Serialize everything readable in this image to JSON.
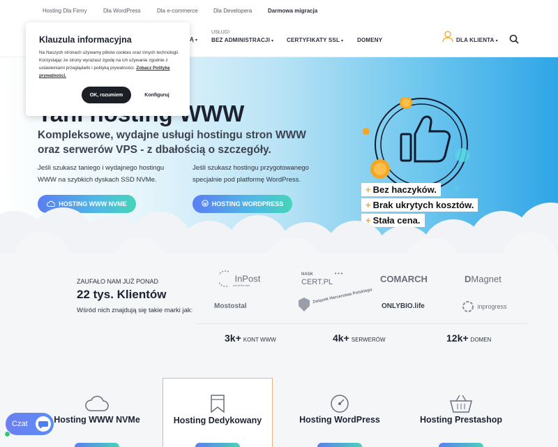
{
  "topbar": {
    "links": [
      "Hosting Dla Firmy",
      "Dla WordPress",
      "Dla e-commerce",
      "Dla Developera",
      "Darmowa migracja"
    ]
  },
  "nav": {
    "partial": "Ą",
    "uslugi_label": "USŁUGI",
    "bez_admin": "BEZ ADMINISTRACJI",
    "ssl": "CERTYFIKATY SSL",
    "domeny": "DOMENY",
    "client": "DLA KLIENTA"
  },
  "hero": {
    "title": "Tani hosting WWW",
    "subtitle": "Kompleksowe, wydajne usługi hostingu stron WWW oraz serwerów VPS - z dbałością o szczegóły.",
    "col1": "Jeśli szukasz taniego i wydajnego hostingu WWW na szybkich dyskach SSD NVMe.",
    "col2": "Jeśli szukasz hostingu przygotowanego specjalnie pod platformę WordPress.",
    "btn1": "HOSTING WWW NVME",
    "btn2": "HOSTING WORDPRESS",
    "pills": [
      "Bez haczyków.",
      "Brak ukrytych kosztów.",
      "Stała cena."
    ]
  },
  "cookie": {
    "title": "Klauzula informacyjna",
    "text": "Na Naszych stronach używamy plików cookies oraz innych technologii. Korzystając ze strony wyrażasz zgodę na ich używanie zgodnie z ustawieniami przeglądarki i polityką prywatności.",
    "link": "Zobacz Politykę prywatności.",
    "ok": "OK, rozumiem",
    "configure": "Konfiguruj"
  },
  "trust": {
    "line1": "ZAUFAŁO NAM JUŻ PONAD",
    "line2": "22 tys. Klientów",
    "line3": "Wśród nich znajdują się takie marki jak:",
    "logos": [
      "InPost",
      "CERT.PL",
      "COMARCH",
      "Magnet",
      "Mostostal",
      "Związek Harcerstwa Polskiego",
      "ONLYBIO.life",
      "inprogress"
    ],
    "logo_sub": {
      "inpost": "out of the box",
      "nask": "NASK"
    }
  },
  "stats": [
    {
      "num": "3k+",
      "label": "KONT WWW"
    },
    {
      "num": "4k+",
      "label": "SERWERÓW"
    },
    {
      "num": "12k+",
      "label": "DOMEN"
    }
  ],
  "cards": [
    {
      "title": "Hosting WWW NVMe",
      "icon": "cloud-icon"
    },
    {
      "title": "Hosting Dedykowany",
      "icon": "bookmark-icon"
    },
    {
      "title": "Hosting WordPress",
      "icon": "gauge-icon"
    },
    {
      "title": "Hosting Prestashop",
      "icon": "basket-icon"
    }
  ],
  "chat": {
    "label": "Czat"
  },
  "colors": {
    "accent_orange": "#f5a623",
    "gradient_start": "#5b7ef2",
    "gradient_end": "#46d4b8",
    "dark_button": "#1d1f26"
  }
}
